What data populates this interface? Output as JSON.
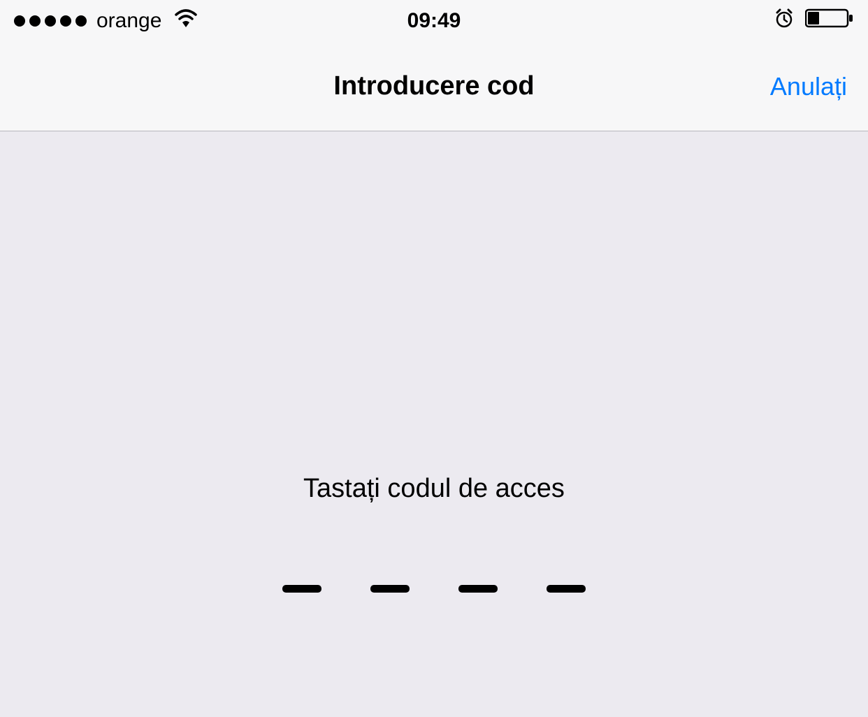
{
  "status_bar": {
    "carrier": "orange",
    "time": "09:49",
    "signal_strength": 5
  },
  "nav": {
    "title": "Introducere cod",
    "cancel_label": "Anulați"
  },
  "content": {
    "prompt": "Tastați codul de acces",
    "passcode_length": 4
  }
}
